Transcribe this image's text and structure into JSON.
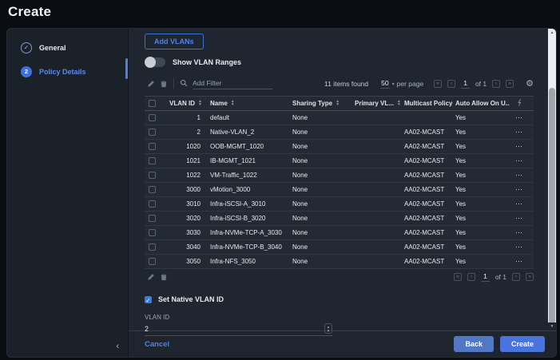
{
  "page": {
    "title": "Create"
  },
  "steps": [
    {
      "number": "",
      "label": "General",
      "state": "complete"
    },
    {
      "number": "2",
      "label": "Policy Details",
      "state": "active"
    }
  ],
  "vlan_section": {
    "add_vlans_button": "Add VLANs",
    "show_vlan_ranges_label": "Show VLAN Ranges",
    "show_vlan_ranges_on": false
  },
  "table": {
    "filter_placeholder": "Add Filter",
    "items_found": "11 items found",
    "per_page": {
      "value": "50",
      "label": "per page"
    },
    "pagination": {
      "page": "1",
      "of_label": "of 1"
    },
    "columns": [
      {
        "label": "VLAN ID",
        "sortable": true,
        "align": "right"
      },
      {
        "label": "Name",
        "sortable": true,
        "align": "left"
      },
      {
        "label": "Sharing Type",
        "sortable": true,
        "align": "left"
      },
      {
        "label": "Primary VL...",
        "sortable": true,
        "align": "left"
      },
      {
        "label": "Multicast Policy",
        "sortable": false,
        "align": "left"
      },
      {
        "label": "Auto Allow On U...",
        "sortable": false,
        "align": "left"
      }
    ],
    "rows": [
      {
        "vlan_id": "1",
        "name": "default",
        "sharing_type": "None",
        "primary_vlan": "",
        "multicast_policy": "",
        "auto_allow": "Yes"
      },
      {
        "vlan_id": "2",
        "name": "Native-VLAN_2",
        "sharing_type": "None",
        "primary_vlan": "",
        "multicast_policy": "AA02-MCAST",
        "auto_allow": "Yes"
      },
      {
        "vlan_id": "1020",
        "name": "OOB-MGMT_1020",
        "sharing_type": "None",
        "primary_vlan": "",
        "multicast_policy": "AA02-MCAST",
        "auto_allow": "Yes"
      },
      {
        "vlan_id": "1021",
        "name": "IB-MGMT_1021",
        "sharing_type": "None",
        "primary_vlan": "",
        "multicast_policy": "AA02-MCAST",
        "auto_allow": "Yes"
      },
      {
        "vlan_id": "1022",
        "name": "VM-Traffic_1022",
        "sharing_type": "None",
        "primary_vlan": "",
        "multicast_policy": "AA02-MCAST",
        "auto_allow": "Yes"
      },
      {
        "vlan_id": "3000",
        "name": "vMotion_3000",
        "sharing_type": "None",
        "primary_vlan": "",
        "multicast_policy": "AA02-MCAST",
        "auto_allow": "Yes"
      },
      {
        "vlan_id": "3010",
        "name": "Infra-iSCSI-A_3010",
        "sharing_type": "None",
        "primary_vlan": "",
        "multicast_policy": "AA02-MCAST",
        "auto_allow": "Yes"
      },
      {
        "vlan_id": "3020",
        "name": "Infra-iSCSI-B_3020",
        "sharing_type": "None",
        "primary_vlan": "",
        "multicast_policy": "AA02-MCAST",
        "auto_allow": "Yes"
      },
      {
        "vlan_id": "3030",
        "name": "Infra-NVMe-TCP-A_3030",
        "sharing_type": "None",
        "primary_vlan": "",
        "multicast_policy": "AA02-MCAST",
        "auto_allow": "Yes"
      },
      {
        "vlan_id": "3040",
        "name": "Infra-NVMe-TCP-B_3040",
        "sharing_type": "None",
        "primary_vlan": "",
        "multicast_policy": "AA02-MCAST",
        "auto_allow": "Yes"
      },
      {
        "vlan_id": "3050",
        "name": "Infra-NFS_3050",
        "sharing_type": "None",
        "primary_vlan": "",
        "multicast_policy": "AA02-MCAST",
        "auto_allow": "Yes"
      }
    ]
  },
  "native_vlan": {
    "checkbox_label": "Set Native VLAN ID",
    "checked": true,
    "field_label": "VLAN ID",
    "field_value": "2"
  },
  "footer": {
    "cancel_label": "Cancel",
    "back_label": "Back",
    "create_label": "Create"
  },
  "icons": {
    "step_complete": "check-circle",
    "edit": "pencil",
    "delete": "trash",
    "search": "magnifier",
    "settings_glyph": "⚙",
    "first_page_glyph": "«",
    "prev_page_glyph": "‹",
    "next_page_glyph": "›",
    "last_page_glyph": "»",
    "row_actions_glyph": "⋯",
    "sort_up_glyph": "▲",
    "sort_down_glyph": "▼",
    "check_glyph": "✓",
    "collapse_glyph": "‹",
    "caret_down_glyph": "▾",
    "stepper_up_glyph": "▲",
    "stepper_down_glyph": "▼",
    "scroll_up_glyph": "▲",
    "scroll_down_glyph": "▼"
  },
  "colors": {
    "accent_blue": "#4e7fe1",
    "link_blue": "#5b8bea",
    "checkbox_blue": "#3a78e7",
    "scroll_track": "#edeeef"
  }
}
